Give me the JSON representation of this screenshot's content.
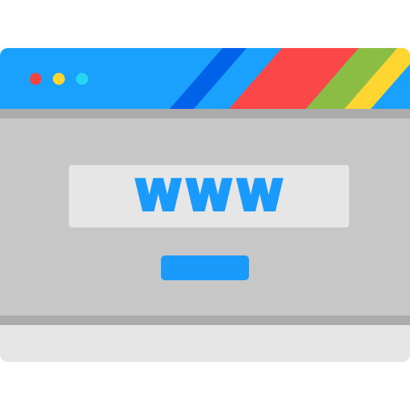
{
  "window": {
    "controls": [
      {
        "name": "close",
        "color": "#ef4545"
      },
      {
        "name": "minimize",
        "color": "#ffd530"
      },
      {
        "name": "maximize",
        "color": "#27d5f0"
      }
    ],
    "titlebar_color": "#1aa0fd",
    "stripe_colors": [
      "#0062e8",
      "#fb4747",
      "#8bbd45",
      "#ffd530"
    ]
  },
  "address_bar": {
    "text": "WWW",
    "text_color": "#1a9bfb",
    "background": "#e6e6e6"
  },
  "go_button": {
    "color": "#1a9bfb"
  },
  "colors": {
    "content_background": "#c7c7c7",
    "divider": "#ababab",
    "statusbar": "#e6e6e6"
  }
}
